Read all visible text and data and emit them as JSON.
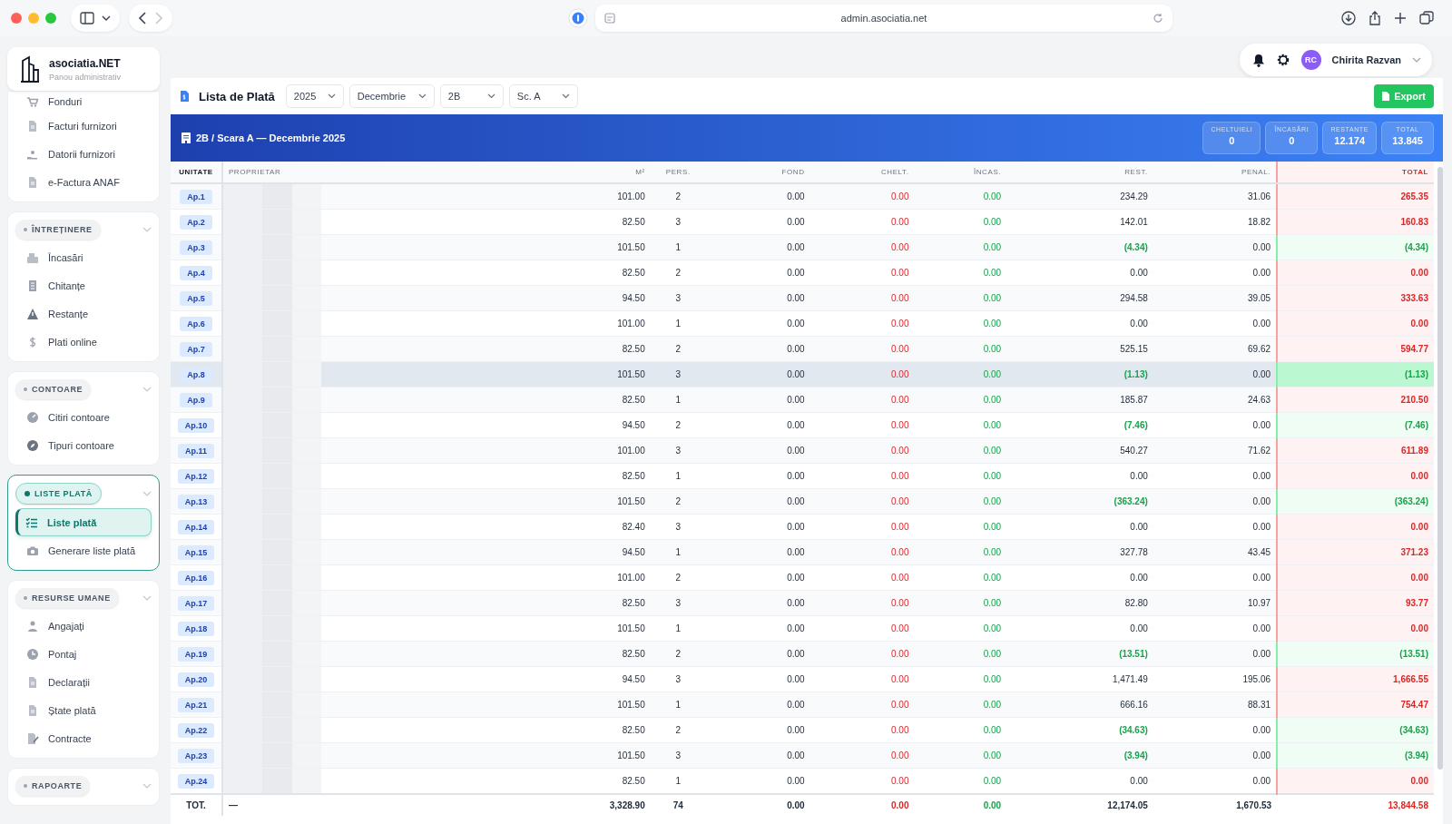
{
  "browser": {
    "url": "admin.asociatia.net"
  },
  "brand": {
    "name": "asociatia.NET",
    "subtitle": "Panou administrativ"
  },
  "sidebar": {
    "groups": [
      {
        "active": false,
        "items": [
          {
            "label": "Fonduri",
            "selected": false
          },
          {
            "label": "Facturi furnizori",
            "selected": false
          },
          {
            "label": "Datorii furnizori",
            "selected": false
          },
          {
            "label": "e-Factura ANAF",
            "selected": false
          }
        ]
      },
      {
        "title": "ÎNTREȚINERE",
        "active": false,
        "items": [
          {
            "label": "Încasări",
            "selected": false
          },
          {
            "label": "Chitanțe",
            "selected": false
          },
          {
            "label": "Restanțe",
            "selected": false
          },
          {
            "label": "Plati online",
            "selected": false
          }
        ]
      },
      {
        "title": "CONTOARE",
        "active": false,
        "items": [
          {
            "label": "Citiri contoare",
            "selected": false
          },
          {
            "label": "Tipuri contoare",
            "selected": false
          }
        ]
      },
      {
        "title": "LISTE PLATĂ",
        "active": true,
        "items": [
          {
            "label": "Liste plată",
            "selected": true
          },
          {
            "label": "Generare liste plată",
            "selected": false
          }
        ]
      },
      {
        "title": "RESURSE UMANE",
        "active": false,
        "items": [
          {
            "label": "Angajați",
            "selected": false
          },
          {
            "label": "Pontaj",
            "selected": false
          },
          {
            "label": "Declarații",
            "selected": false
          },
          {
            "label": "Ștate plată",
            "selected": false
          },
          {
            "label": "Contracte",
            "selected": false
          }
        ]
      },
      {
        "title": "RAPOARTE",
        "active": false
      }
    ]
  },
  "user": {
    "initials": "RC",
    "name": "Chirita Razvan"
  },
  "toolbar": {
    "title": "Lista de Plată",
    "filters": [
      "2025",
      "Decembrie",
      "2B",
      "Sc. A"
    ],
    "export": "Export"
  },
  "banner": {
    "title": "2B / Scara A — Decembrie 2025",
    "stats": [
      {
        "label": "CHELTUIELI",
        "value": "0"
      },
      {
        "label": "ÎNCASĂRI",
        "value": "0"
      },
      {
        "label": "RESTANȚE",
        "value": "12.174"
      },
      {
        "label": "TOTAL",
        "value": "13.845"
      }
    ]
  },
  "table": {
    "columns": [
      "UNITATE",
      "PROPRIETAR",
      "M²",
      "PERS.",
      "FOND",
      "CHELT.",
      "ÎNCAS.",
      "REST.",
      "PENAL.",
      "TOTAL"
    ],
    "rows": [
      {
        "unit": "Ap.1",
        "m2": "101.00",
        "pers": "2",
        "fond": "0.00",
        "chelt": "0.00",
        "incas": "0.00",
        "rest": "234.29",
        "penal": "31.06",
        "total": "265.35",
        "credit": false,
        "selected": false
      },
      {
        "unit": "Ap.2",
        "m2": "82.50",
        "pers": "3",
        "fond": "0.00",
        "chelt": "0.00",
        "incas": "0.00",
        "rest": "142.01",
        "penal": "18.82",
        "total": "160.83",
        "credit": false,
        "selected": false
      },
      {
        "unit": "Ap.3",
        "m2": "101.50",
        "pers": "1",
        "fond": "0.00",
        "chelt": "0.00",
        "incas": "0.00",
        "rest": "(4.34)",
        "penal": "0.00",
        "total": "(4.34)",
        "credit": true,
        "selected": false
      },
      {
        "unit": "Ap.4",
        "m2": "82.50",
        "pers": "2",
        "fond": "0.00",
        "chelt": "0.00",
        "incas": "0.00",
        "rest": "0.00",
        "penal": "0.00",
        "total": "0.00",
        "credit": false,
        "selected": false
      },
      {
        "unit": "Ap.5",
        "m2": "94.50",
        "pers": "3",
        "fond": "0.00",
        "chelt": "0.00",
        "incas": "0.00",
        "rest": "294.58",
        "penal": "39.05",
        "total": "333.63",
        "credit": false,
        "selected": false
      },
      {
        "unit": "Ap.6",
        "m2": "101.00",
        "pers": "1",
        "fond": "0.00",
        "chelt": "0.00",
        "incas": "0.00",
        "rest": "0.00",
        "penal": "0.00",
        "total": "0.00",
        "credit": false,
        "selected": false
      },
      {
        "unit": "Ap.7",
        "m2": "82.50",
        "pers": "2",
        "fond": "0.00",
        "chelt": "0.00",
        "incas": "0.00",
        "rest": "525.15",
        "penal": "69.62",
        "total": "594.77",
        "credit": false,
        "selected": false
      },
      {
        "unit": "Ap.8",
        "m2": "101.50",
        "pers": "3",
        "fond": "0.00",
        "chelt": "0.00",
        "incas": "0.00",
        "rest": "(1.13)",
        "penal": "0.00",
        "total": "(1.13)",
        "credit": true,
        "selected": true
      },
      {
        "unit": "Ap.9",
        "m2": "82.50",
        "pers": "1",
        "fond": "0.00",
        "chelt": "0.00",
        "incas": "0.00",
        "rest": "185.87",
        "penal": "24.63",
        "total": "210.50",
        "credit": false,
        "selected": false
      },
      {
        "unit": "Ap.10",
        "m2": "94.50",
        "pers": "2",
        "fond": "0.00",
        "chelt": "0.00",
        "incas": "0.00",
        "rest": "(7.46)",
        "penal": "0.00",
        "total": "(7.46)",
        "credit": true,
        "selected": false
      },
      {
        "unit": "Ap.11",
        "m2": "101.00",
        "pers": "3",
        "fond": "0.00",
        "chelt": "0.00",
        "incas": "0.00",
        "rest": "540.27",
        "penal": "71.62",
        "total": "611.89",
        "credit": false,
        "selected": false
      },
      {
        "unit": "Ap.12",
        "m2": "82.50",
        "pers": "1",
        "fond": "0.00",
        "chelt": "0.00",
        "incas": "0.00",
        "rest": "0.00",
        "penal": "0.00",
        "total": "0.00",
        "credit": false,
        "selected": false
      },
      {
        "unit": "Ap.13",
        "m2": "101.50",
        "pers": "2",
        "fond": "0.00",
        "chelt": "0.00",
        "incas": "0.00",
        "rest": "(363.24)",
        "penal": "0.00",
        "total": "(363.24)",
        "credit": true,
        "selected": false
      },
      {
        "unit": "Ap.14",
        "m2": "82.40",
        "pers": "3",
        "fond": "0.00",
        "chelt": "0.00",
        "incas": "0.00",
        "rest": "0.00",
        "penal": "0.00",
        "total": "0.00",
        "credit": false,
        "selected": false
      },
      {
        "unit": "Ap.15",
        "m2": "94.50",
        "pers": "1",
        "fond": "0.00",
        "chelt": "0.00",
        "incas": "0.00",
        "rest": "327.78",
        "penal": "43.45",
        "total": "371.23",
        "credit": false,
        "selected": false
      },
      {
        "unit": "Ap.16",
        "m2": "101.00",
        "pers": "2",
        "fond": "0.00",
        "chelt": "0.00",
        "incas": "0.00",
        "rest": "0.00",
        "penal": "0.00",
        "total": "0.00",
        "credit": false,
        "selected": false
      },
      {
        "unit": "Ap.17",
        "m2": "82.50",
        "pers": "3",
        "fond": "0.00",
        "chelt": "0.00",
        "incas": "0.00",
        "rest": "82.80",
        "penal": "10.97",
        "total": "93.77",
        "credit": false,
        "selected": false
      },
      {
        "unit": "Ap.18",
        "m2": "101.50",
        "pers": "1",
        "fond": "0.00",
        "chelt": "0.00",
        "incas": "0.00",
        "rest": "0.00",
        "penal": "0.00",
        "total": "0.00",
        "credit": false,
        "selected": false
      },
      {
        "unit": "Ap.19",
        "m2": "82.50",
        "pers": "2",
        "fond": "0.00",
        "chelt": "0.00",
        "incas": "0.00",
        "rest": "(13.51)",
        "penal": "0.00",
        "total": "(13.51)",
        "credit": true,
        "selected": false
      },
      {
        "unit": "Ap.20",
        "m2": "94.50",
        "pers": "3",
        "fond": "0.00",
        "chelt": "0.00",
        "incas": "0.00",
        "rest": "1,471.49",
        "penal": "195.06",
        "total": "1,666.55",
        "credit": false,
        "selected": false
      },
      {
        "unit": "Ap.21",
        "m2": "101.50",
        "pers": "1",
        "fond": "0.00",
        "chelt": "0.00",
        "incas": "0.00",
        "rest": "666.16",
        "penal": "88.31",
        "total": "754.47",
        "credit": false,
        "selected": false
      },
      {
        "unit": "Ap.22",
        "m2": "82.50",
        "pers": "2",
        "fond": "0.00",
        "chelt": "0.00",
        "incas": "0.00",
        "rest": "(34.63)",
        "penal": "0.00",
        "total": "(34.63)",
        "credit": true,
        "selected": false
      },
      {
        "unit": "Ap.23",
        "m2": "101.50",
        "pers": "3",
        "fond": "0.00",
        "chelt": "0.00",
        "incas": "0.00",
        "rest": "(3.94)",
        "penal": "0.00",
        "total": "(3.94)",
        "credit": true,
        "selected": false
      },
      {
        "unit": "Ap.24",
        "m2": "82.50",
        "pers": "1",
        "fond": "0.00",
        "chelt": "0.00",
        "incas": "0.00",
        "rest": "0.00",
        "penal": "0.00",
        "total": "0.00",
        "credit": false,
        "selected": false
      }
    ],
    "totals": {
      "unit": "TOT.",
      "owner": "—",
      "m2": "3,328.90",
      "pers": "74",
      "fond": "0.00",
      "chelt": "0.00",
      "incas": "0.00",
      "rest": "12,174.05",
      "penal": "1,670.53",
      "total": "13,844.58"
    }
  }
}
